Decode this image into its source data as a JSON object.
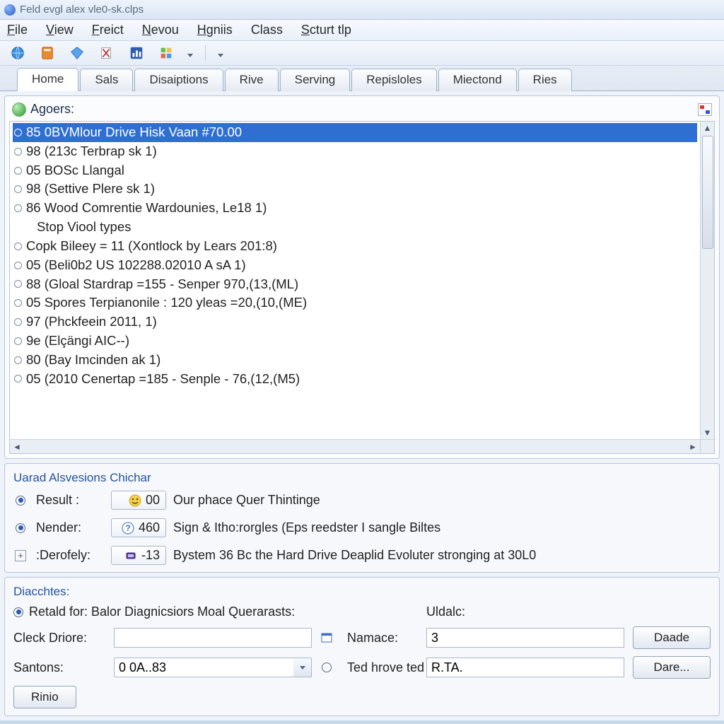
{
  "window": {
    "title": "Feld evgl alex vle0-sk.clps"
  },
  "menu": {
    "file": "File",
    "view": "View",
    "freict": "Freict",
    "nevou": "Nevou",
    "hgnis": "Hgniis",
    "class": "Class",
    "sturt": "Scturt tlp"
  },
  "tabs": {
    "items": [
      {
        "label": "Home"
      },
      {
        "label": "Sals"
      },
      {
        "label": "Disaiptions"
      },
      {
        "label": "Rive"
      },
      {
        "label": "Serving"
      },
      {
        "label": "Repisloles"
      },
      {
        "label": "Miectond"
      },
      {
        "label": "Ries"
      }
    ],
    "active_index": 0
  },
  "list": {
    "header_label": "Agoers:",
    "items": [
      "85 0BVMlour Drive Hisk Vaan #70.00",
      "98 (213c Terbrap sk 1)",
      "05 BOSc Llangal",
      "98 (Settive Plere sk 1)",
      "86 Wood Comrentie Wardounies, Le18 1)",
      "Stop Viool types",
      "Copk Bileey = 11 (Xontlock by Lears 201:8)",
      "05 (Beli0b2 US 102288.02010 A sA 1)",
      "88 (Gloal Stardrap =155 - Senper 970,(13,(ML)",
      "05 Spores Terpianonile : 120 yleas =20,(10,(ME)",
      "97 (Phckfeein 2011, 1)",
      "9e (Elçängi AIC--)",
      "80 (Bay Imcinden ak 1)",
      "05 (2010 Cenertap =185 - Senple - 76,(12,(M5)"
    ],
    "noicon_indices": [
      5
    ],
    "selected_index": 0
  },
  "alsv": {
    "title": "Uarad Alsvesions Chichar",
    "rows": [
      {
        "label": "Result :",
        "value": "00",
        "desc": "Our phace Quer Thintinge",
        "icon": "smile"
      },
      {
        "label": "Nender:",
        "value": "460",
        "desc": "Sign & Itho:rorgles (Eps reedster I sangle Biltes",
        "icon": "question"
      },
      {
        "label": ":Derofely:",
        "value": "-13",
        "desc": "Bystem 36 Bc the Hard Drive Deaplid Evoluter stronging at 30L0",
        "icon": "chip"
      }
    ]
  },
  "diacchtes": {
    "title": "Diacchtes:",
    "retald_label": "Retald for: Balor Diagnicsiors Moal Querarasts:",
    "uldalc_label": "Uldalc:",
    "cleck_label": "Cleck Driore:",
    "cleck_value": "",
    "namace_label": "Namace:",
    "namace_value": "3",
    "santons_label": "Santons:",
    "santons_value": "0 0A..83",
    "ted_label": "Ted hrove ted Apps:",
    "ted_value": "R.TA.",
    "btn_daade": "Daade",
    "btn_dare": "Dare...",
    "btn_rinio": "Rinio"
  },
  "icons": {
    "globe": "globe-icon",
    "hdoc": "orange-doc-icon",
    "gem": "gem-icon",
    "sheet": "sheet-icon",
    "chart": "chart-icon",
    "tools": "tools-icon"
  }
}
